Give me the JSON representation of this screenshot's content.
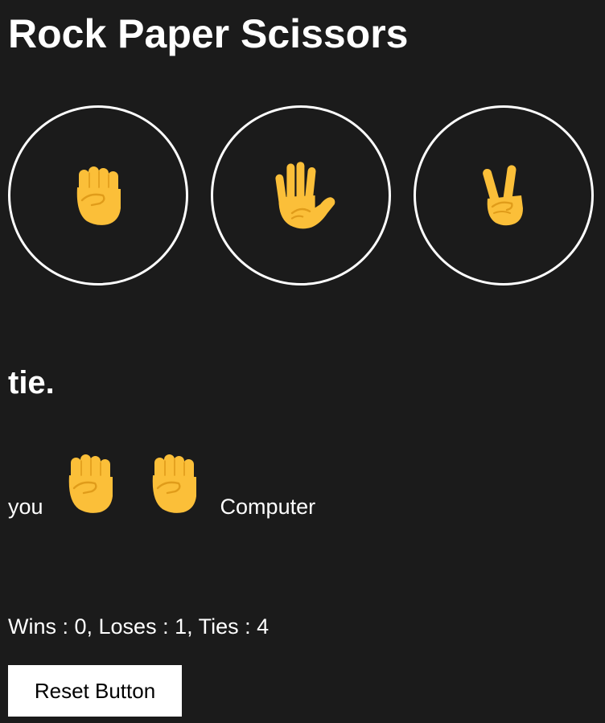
{
  "title": "Rock Paper Scissors",
  "choices": [
    {
      "name": "rock",
      "icon": "raised-fist-icon"
    },
    {
      "name": "paper",
      "icon": "raised-hand-icon"
    },
    {
      "name": "scissors",
      "icon": "victory-hand-icon"
    }
  ],
  "result": "tie.",
  "matchup": {
    "player_label": "you",
    "player_choice_icon": "raised-fist-icon",
    "computer_choice_icon": "raised-fist-icon",
    "computer_label": "Computer"
  },
  "score_text": "Wins : 0, Loses : 1, Ties : 4",
  "reset_label": "Reset Button",
  "colors": {
    "background": "#1b1b1b",
    "text": "#ffffff",
    "hand": "#fbbf39",
    "hand_line": "#e09c1a"
  }
}
